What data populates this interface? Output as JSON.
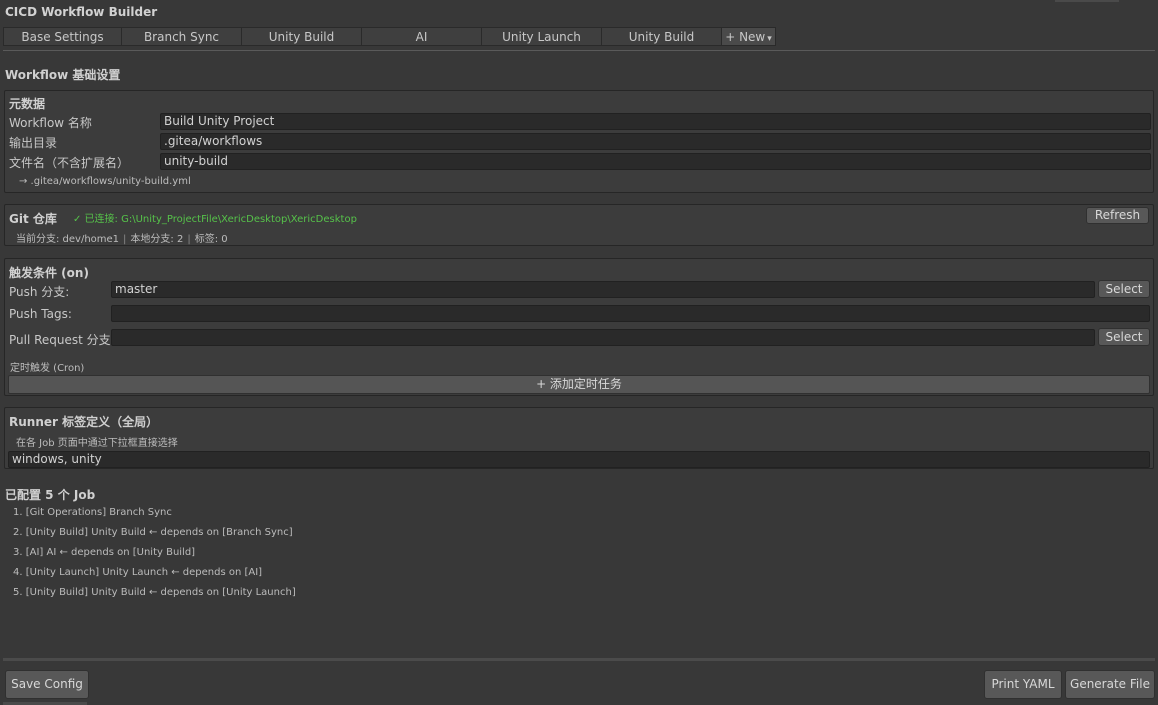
{
  "window": {
    "title": "CICD Workflow Builder"
  },
  "tabs": [
    {
      "label": "Base Settings"
    },
    {
      "label": "Branch Sync"
    },
    {
      "label": "Unity Build"
    },
    {
      "label": "AI"
    },
    {
      "label": "Unity Launch"
    },
    {
      "label": "Unity Build"
    }
  ],
  "new_tab": {
    "label": "+ New",
    "caret": "▾"
  },
  "page_heading": "Workflow 基础设置",
  "metadata": {
    "title": "元数据",
    "name_label": "Workflow 名称",
    "name_value": "Build Unity Project",
    "output_label": "输出目录",
    "output_value": ".gitea/workflows",
    "filename_label": "文件名（不含扩展名）",
    "filename_value": "unity-build",
    "resolved_path": "→ .gitea/workflows/unity-build.yml"
  },
  "git": {
    "title": "Git 仓库",
    "status": "✓ 已连接: G:\\Unity_ProjectFile\\XericDesktop\\XericDesktop",
    "status_color": "#56c24a",
    "refresh_label": "Refresh",
    "current_branch": "当前分支: dev/home1",
    "local_branches": "本地分支: 2",
    "tags": "标签: 0"
  },
  "triggers": {
    "title": "触发条件 (on)",
    "push_branch_label": "Push 分支:",
    "push_branch_value": "master",
    "push_tags_label": "Push Tags:",
    "push_tags_value": "",
    "pr_branch_label": "Pull Request 分支",
    "pr_branch_value": "",
    "select_label": "Select",
    "cron_label": "定时触发 (Cron)",
    "add_cron_label": "+ 添加定时任务"
  },
  "runner": {
    "title": "Runner 标签定义（全局）",
    "hint": "在各 Job 页面中通过下拉框直接选择",
    "value": "windows, unity"
  },
  "jobs": {
    "title": "已配置 5 个 Job",
    "items": [
      "1. [Git Operations] Branch Sync",
      "2. [Unity Build] Unity Build  ← depends on [Branch Sync]",
      "3. [AI] AI  ← depends on [Unity Build]",
      "4. [Unity Launch] Unity Launch  ← depends on [AI]",
      "5. [Unity Build] Unity Build  ← depends on [Unity Launch]"
    ]
  },
  "footer": {
    "save_label": "Save Config",
    "print_label": "Print YAML",
    "generate_label": "Generate File"
  },
  "colors": {
    "background": "#383838",
    "panel": "#3c3c3c",
    "field": "#2a2a2a",
    "button": "#585858"
  }
}
